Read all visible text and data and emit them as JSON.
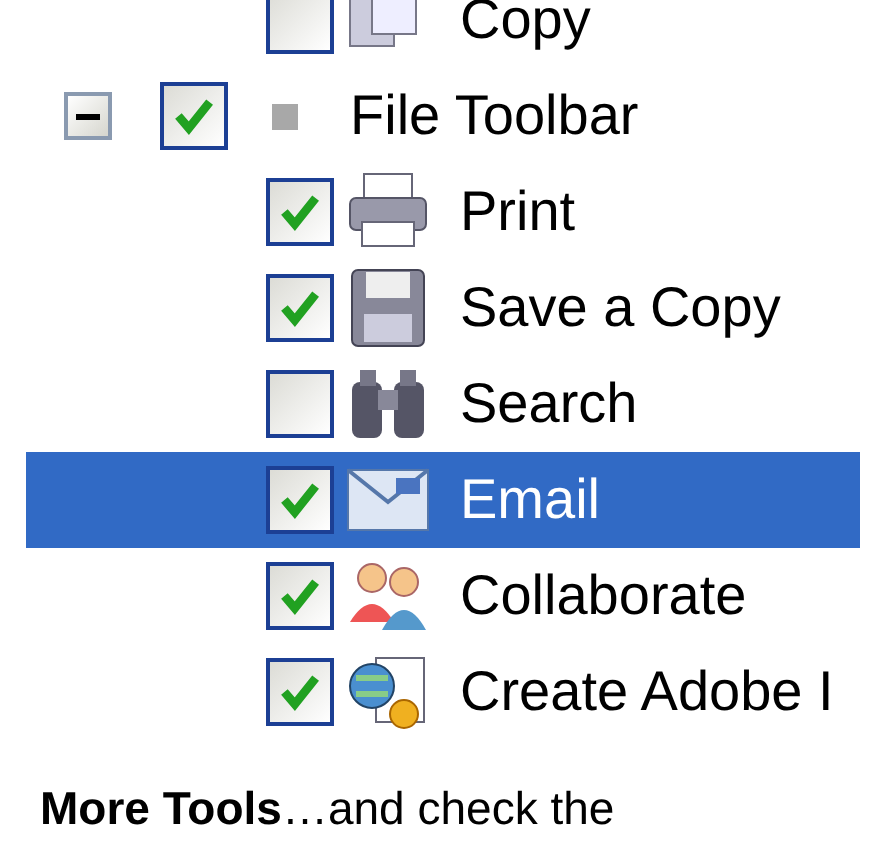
{
  "tree": {
    "items": [
      {
        "kind": "group-tail",
        "children": [
          {
            "label": "Copy",
            "checked": false,
            "selected": false
          }
        ]
      },
      {
        "kind": "toolbar",
        "label": "File Toolbar",
        "checked": true,
        "expanded": true,
        "selected": false,
        "children": [
          {
            "label": "Print",
            "checked": true,
            "selected": false
          },
          {
            "label": "Save a Copy",
            "checked": true,
            "selected": false
          },
          {
            "label": "Search",
            "checked": false,
            "selected": false
          },
          {
            "label": "Email",
            "checked": true,
            "selected": true
          },
          {
            "label": "Collaborate",
            "checked": true,
            "selected": false
          },
          {
            "label": "Create Adobe I",
            "checked": true,
            "selected": false
          }
        ]
      }
    ]
  },
  "caption": "**More Tools**…and check the"
}
